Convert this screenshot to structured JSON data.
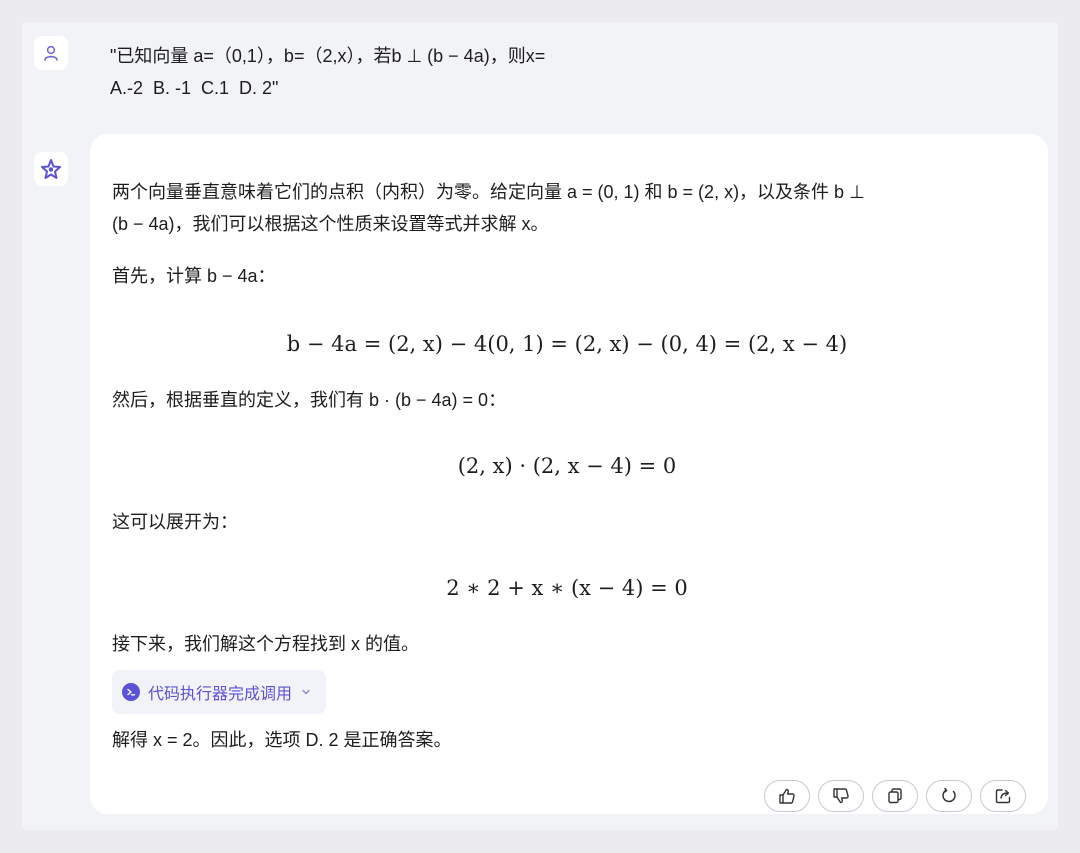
{
  "user_message": {
    "line1": "\"已知向量 a=（0,1），b=（2,x），若b ⊥ (b − 4a)，则x=",
    "line2": "A.-2  B. -1  C.1  D. 2\""
  },
  "assistant": {
    "p1_line1": "两个向量垂直意味着它们的点积（内积）为零。给定向量 a = (0, 1) 和 b = (2, x)，以及条件 b ⊥",
    "p1_line2": "(b − 4a)，我们可以根据这个性质来设置等式并求解 x。",
    "p2": "首先，计算 b − 4a：",
    "eq1": "b − 4a = (2, x) − 4(0, 1) = (2, x) − (0, 4) = (2, x − 4)",
    "p3": "然后，根据垂直的定义，我们有 b · (b − 4a) = 0：",
    "eq2": "(2, x) · (2, x − 4) = 0",
    "p4": "这可以展开为：",
    "eq3": "2 ∗ 2 + x ∗ (x − 4) = 0",
    "p5": "接下来，我们解这个方程找到 x 的值。",
    "tool_label": "代码执行器完成调用",
    "p6": "解得 x = 2。因此，选项 D. 2 是正确答案。"
  },
  "actions": [
    {
      "name": "thumbs-up-icon"
    },
    {
      "name": "thumbs-down-icon"
    },
    {
      "name": "copy-icon"
    },
    {
      "name": "regenerate-icon"
    },
    {
      "name": "share-icon"
    }
  ],
  "colors": {
    "accent": "#5b52d6",
    "background": "#f2f3f7",
    "bubble": "#ffffff"
  }
}
